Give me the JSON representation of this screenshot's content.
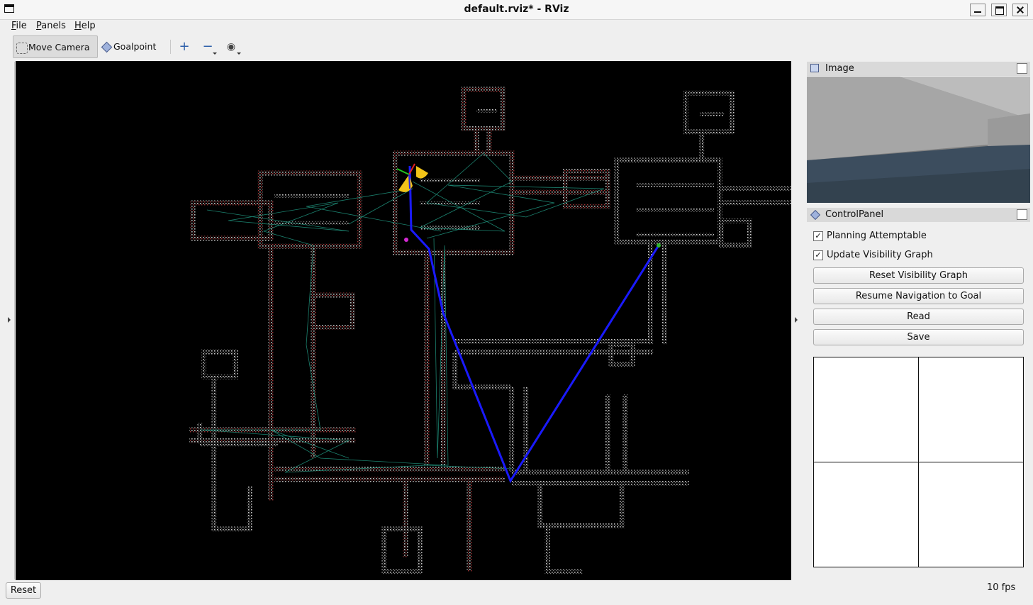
{
  "window": {
    "title": "default.rviz* - RViz"
  },
  "menu": [
    "File",
    "Panels",
    "Help"
  ],
  "toolbar": {
    "move_camera_label": "Move Camera",
    "goalpoint_label": "Goalpoint",
    "tools": [
      "plus-icon",
      "minus-icon",
      "eye-icon"
    ]
  },
  "panels": {
    "image": {
      "title": "Image"
    },
    "control": {
      "title": "ControlPanel",
      "checkboxes": [
        {
          "label": "Planning Attemptable",
          "checked": true
        },
        {
          "label": "Update Visibility Graph",
          "checked": true
        }
      ],
      "buttons": [
        "Reset Visibility Graph",
        "Resume Navigation to Goal",
        "Read",
        "Save"
      ]
    }
  },
  "status": {
    "reset_label": "Reset",
    "fps": "10 fps"
  },
  "colors": {
    "path": "#1a1aff",
    "graph": "#1f8f7a",
    "map_points": "#bfbfbf",
    "map_points_red": "#b23a3a",
    "viewport_bg": "#000000"
  }
}
